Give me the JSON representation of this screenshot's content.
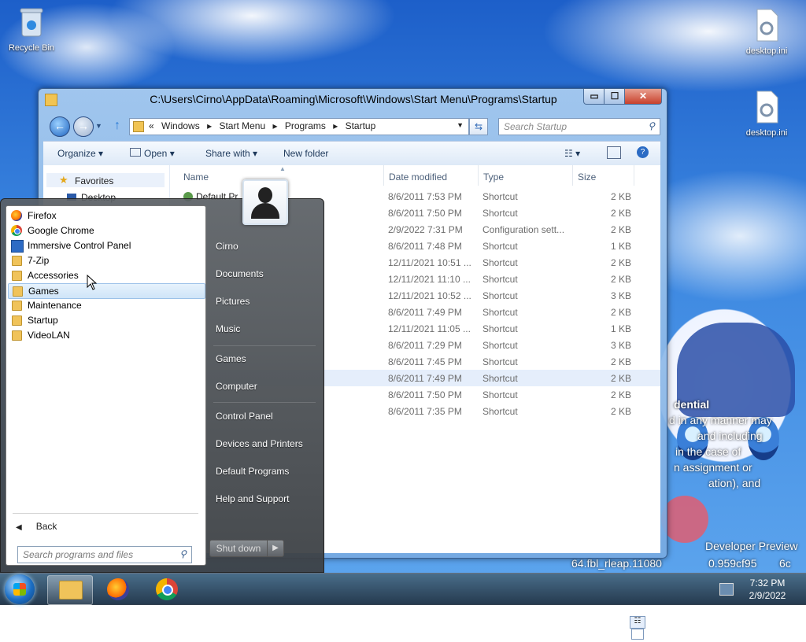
{
  "desktop": {
    "icons": [
      {
        "label": "Recycle Bin"
      },
      {
        "label": "desktop.ini"
      },
      {
        "label": "desktop.ini"
      }
    ],
    "watermark": [
      "dential",
      "d in any manner may",
      "and including",
      "in the case of",
      "n assignment or",
      "ation), and",
      "Developer Preview",
      "64.fbl_rleap.11080",
      "0.959cf95",
      "6c"
    ]
  },
  "explorer": {
    "title": "C:\\Users\\Cirno\\AppData\\Roaming\\Microsoft\\Windows\\Start Menu\\Programs\\Startup",
    "caption": {
      "minimize": "▭",
      "maximize": "☐",
      "close": "✕"
    },
    "address": {
      "prefix": "«",
      "crumbs": [
        "Windows",
        "Start Menu",
        "Programs",
        "Startup"
      ],
      "separator": "▸"
    },
    "search_placeholder": "Search Startup",
    "toolbar": {
      "organize": "Organize",
      "open": "Open",
      "share_with": "Share with",
      "new_folder": "New folder"
    },
    "nav": {
      "favorites": "Favorites",
      "desktop": "Desktop"
    },
    "columns": {
      "name": "Name",
      "date_modified": "Date modified",
      "type": "Type",
      "size": "Size"
    },
    "first_name_visible": "Default Pr",
    "rows": [
      {
        "date": "8/6/2011 7:53 PM",
        "type": "Shortcut",
        "size": "2 KB"
      },
      {
        "date": "8/6/2011 7:50 PM",
        "type": "Shortcut",
        "size": "2 KB"
      },
      {
        "date": "2/9/2022 7:31 PM",
        "type": "Configuration sett...",
        "size": "2 KB"
      },
      {
        "date": "8/6/2011 7:48 PM",
        "type": "Shortcut",
        "size": "1 KB"
      },
      {
        "date": "12/11/2021 10:51 ...",
        "type": "Shortcut",
        "size": "2 KB"
      },
      {
        "date": "12/11/2021 11:10 ...",
        "type": "Shortcut",
        "size": "2 KB"
      },
      {
        "date": "12/11/2021 10:52 ...",
        "type": "Shortcut",
        "size": "3 KB"
      },
      {
        "date": "8/6/2011 7:49 PM",
        "type": "Shortcut",
        "size": "2 KB"
      },
      {
        "date": "12/11/2021 11:05 ...",
        "type": "Shortcut",
        "size": "1 KB"
      },
      {
        "date": "8/6/2011 7:29 PM",
        "type": "Shortcut",
        "size": "3 KB"
      },
      {
        "date": "8/6/2011 7:45 PM",
        "type": "Shortcut",
        "size": "2 KB"
      },
      {
        "date": "8/6/2011 7:49 PM",
        "type": "Shortcut",
        "size": "2 KB"
      },
      {
        "date": "8/6/2011 7:50 PM",
        "type": "Shortcut",
        "size": "2 KB"
      },
      {
        "date": "8/6/2011 7:35 PM",
        "type": "Shortcut",
        "size": "2 KB"
      }
    ]
  },
  "start_menu": {
    "programs": [
      {
        "label": "Firefox",
        "icon": "firefox-icon"
      },
      {
        "label": "Google Chrome",
        "icon": "chrome-icon"
      },
      {
        "label": "Immersive Control Panel",
        "icon": "control-panel-icon"
      },
      {
        "label": "7-Zip",
        "icon": "folder-icon"
      },
      {
        "label": "Accessories",
        "icon": "folder-icon"
      },
      {
        "label": "Games",
        "icon": "folder-icon"
      },
      {
        "label": "Maintenance",
        "icon": "folder-icon"
      },
      {
        "label": "Startup",
        "icon": "folder-icon"
      },
      {
        "label": "VideoLAN",
        "icon": "folder-icon"
      }
    ],
    "selected_program": "Games",
    "back_label": "Back",
    "search_placeholder": "Search programs and files",
    "right": {
      "user": "Cirno",
      "documents": "Documents",
      "pictures": "Pictures",
      "music": "Music",
      "games": "Games",
      "computer": "Computer",
      "control_panel": "Control Panel",
      "devices_printers": "Devices and Printers",
      "default_programs": "Default Programs",
      "help_support": "Help and Support"
    },
    "shutdown": "Shut down",
    "shutdown_arrow": "▶"
  },
  "taskbar": {
    "time": "7:32 PM",
    "date": "2/9/2022"
  }
}
